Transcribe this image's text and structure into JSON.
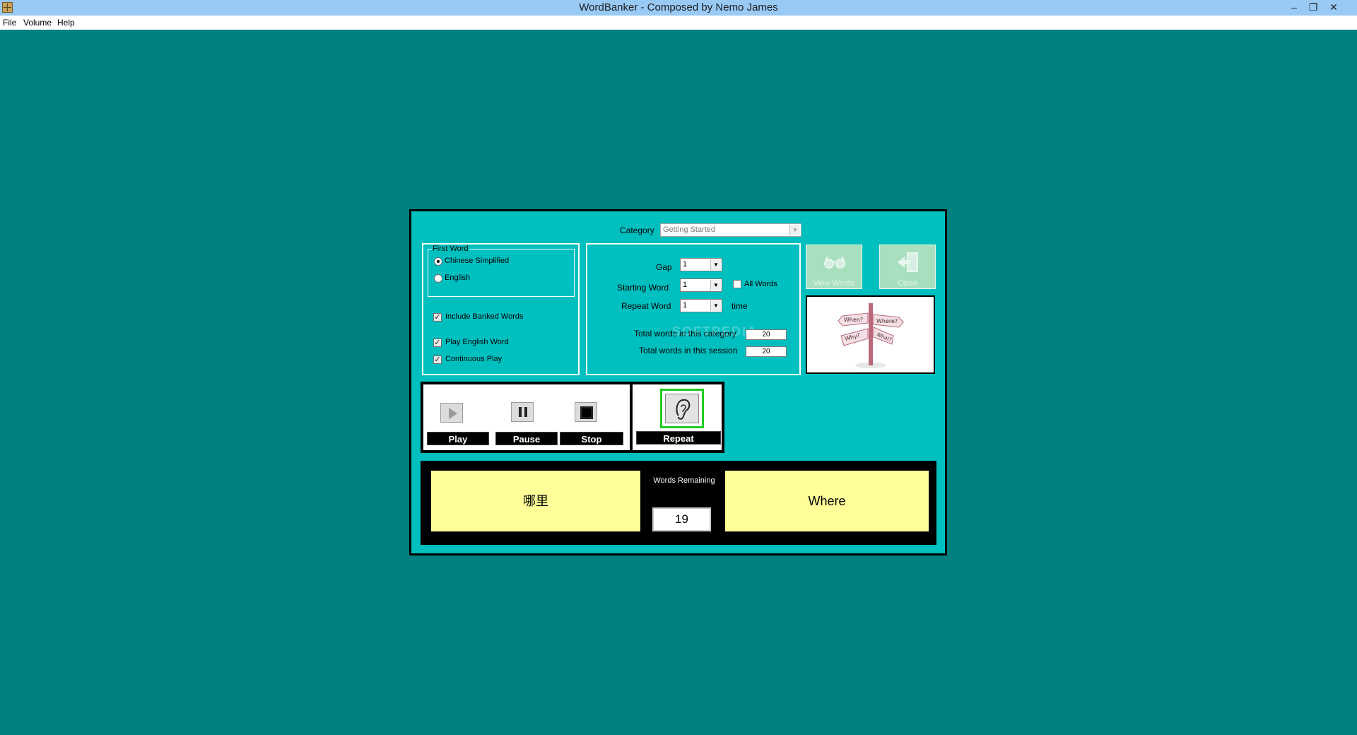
{
  "window": {
    "title": "WordBanker - Composed by Nemo James",
    "minimize": "–",
    "restore": "❐",
    "close": "✕"
  },
  "menu": {
    "file": "File",
    "volume": "Volume",
    "help": "Help"
  },
  "category": {
    "label": "Category",
    "value": "Getting Started"
  },
  "first_word": {
    "legend": "First Word",
    "options": [
      "Chinese Simplified",
      "English"
    ],
    "selected": "Chinese Simplified"
  },
  "options": {
    "include_banked": "Include Banked Words",
    "play_english": "Play English Word",
    "continuous_play": "Continuous Play"
  },
  "settings": {
    "gap_label": "Gap",
    "gap_value": "1",
    "starting_word_label": "Starting Word",
    "starting_word_value": "1",
    "all_words_label": "All Words",
    "repeat_word_label": "Repeat Word",
    "repeat_word_value": "1",
    "time_label": "time",
    "total_category_label": "Total words in this category",
    "total_category_value": "20",
    "total_session_label": "Total words in this session",
    "total_session_value": "20"
  },
  "buttons": {
    "view_words": "View Words",
    "close": "Close"
  },
  "signpost": [
    "When?",
    "Where?",
    "Why?",
    "What?"
  ],
  "playback": {
    "play": "Play",
    "pause": "Pause",
    "stop": "Stop",
    "repeat": "Repeat"
  },
  "words": {
    "chinese": "哪里",
    "english": "Where",
    "remaining_label": "Words Remaining",
    "remaining_value": "19"
  },
  "watermark": "SOFTPEDIA",
  "colors": {
    "desktop": "#008080",
    "panel": "#00bfbf",
    "word_box": "#ffff99",
    "repeat_border": "#22cc22"
  },
  "icons": {
    "app": "book-icon",
    "view_words": "glasses-icon",
    "close": "exit-door-icon",
    "repeat": "ear-icon"
  }
}
